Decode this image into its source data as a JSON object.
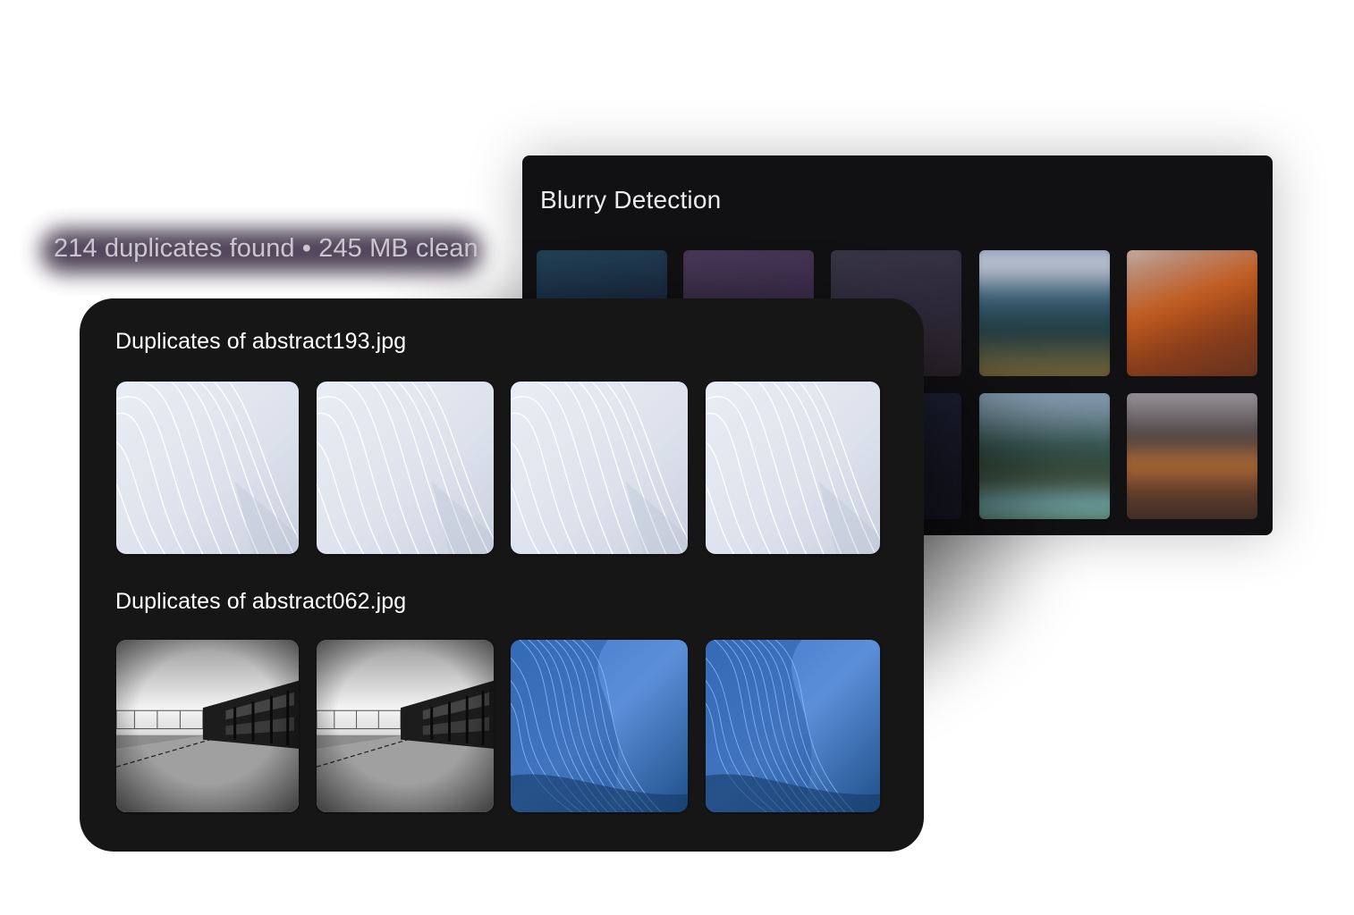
{
  "stats": {
    "text": "214 duplicates found • 245 MB clean"
  },
  "blurry": {
    "title": "Blurry Detection",
    "thumbs": [
      {
        "name": "blur-thumb-teal"
      },
      {
        "name": "blur-thumb-purple"
      },
      {
        "name": "blur-thumb-dusk"
      },
      {
        "name": "blur-thumb-mountain-valley"
      },
      {
        "name": "blur-thumb-orange-ridge"
      },
      {
        "name": "blur-thumb-dark-violet"
      },
      {
        "name": "blur-thumb-green-mountain"
      },
      {
        "name": "blur-thumb-amber-sunset"
      }
    ]
  },
  "duplicates": {
    "groups": [
      {
        "title": "Duplicates of abstract193.jpg",
        "thumbs": [
          "white-wave",
          "white-wave",
          "white-wave",
          "white-wave"
        ]
      },
      {
        "title": "Duplicates of abstract062.jpg",
        "thumbs": [
          "bw-building",
          "bw-building",
          "blue-wave",
          "blue-wave"
        ]
      }
    ]
  },
  "colors": {
    "panel_bg": "#161617",
    "blurry_bg": "#111114",
    "title_text": "#ffffff",
    "stats_text": "#c9c6ce"
  }
}
